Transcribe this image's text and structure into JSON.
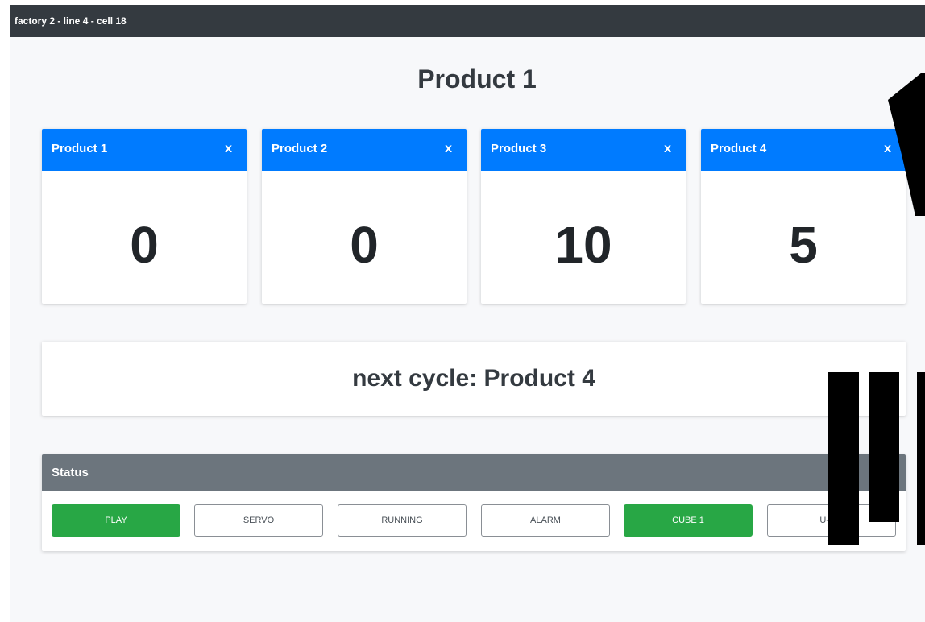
{
  "window": {
    "title": "factory 2 - line 4 - cell 18"
  },
  "page_title": "Product 1",
  "products": [
    {
      "label": "Product 1",
      "close": "x",
      "count": "0"
    },
    {
      "label": "Product 2",
      "close": "x",
      "count": "0"
    },
    {
      "label": "Product 3",
      "close": "x",
      "count": "10"
    },
    {
      "label": "Product 4",
      "close": "x",
      "count": "5"
    }
  ],
  "next_cycle": {
    "text": "next cycle: Product 4"
  },
  "status": {
    "title": "Status",
    "buttons": [
      {
        "label": "PLAY",
        "active": true
      },
      {
        "label": "SERVO",
        "active": false
      },
      {
        "label": "RUNNING",
        "active": false
      },
      {
        "label": "ALARM",
        "active": false
      },
      {
        "label": "CUBE 1",
        "active": true
      },
      {
        "label": "U-Job",
        "active": false
      }
    ]
  },
  "colors": {
    "titlebar": "#343a40",
    "card_header": "#007bff",
    "status_header": "#6c757d",
    "active_green": "#28a745",
    "background": "#f7f8fa"
  }
}
